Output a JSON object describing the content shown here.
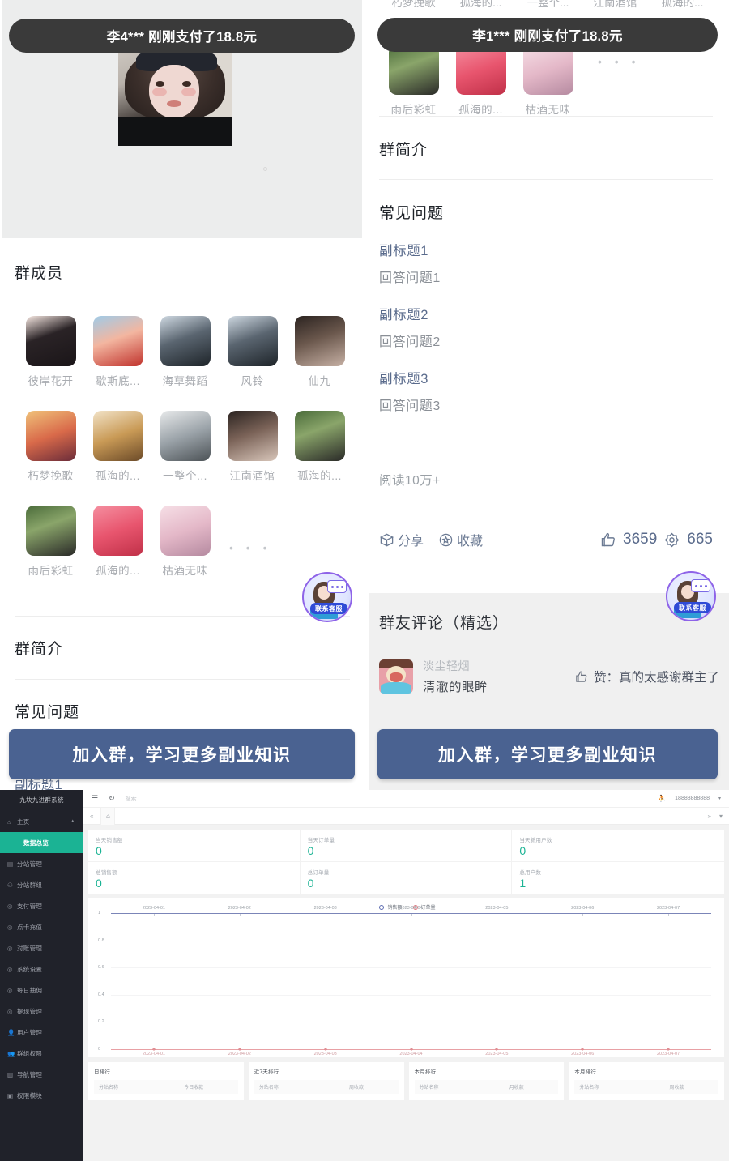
{
  "mobile": {
    "toast_left": "李4*** 刚刚支付了18.8元",
    "toast_right": "李1*** 刚刚支付了18.8元",
    "members_title": "群成员",
    "members": [
      {
        "name": "彼岸花开"
      },
      {
        "name": "歇斯底..."
      },
      {
        "name": "海草舞蹈"
      },
      {
        "name": "风铃"
      },
      {
        "name": "仙九"
      },
      {
        "name": "朽梦挽歌"
      },
      {
        "name": "孤海的..."
      },
      {
        "name": "一整个..."
      },
      {
        "name": "江南酒馆"
      },
      {
        "name": "孤海的..."
      },
      {
        "name": "雨后彩虹"
      },
      {
        "name": "孤海的..."
      },
      {
        "name": "枯酒无味"
      }
    ],
    "more_dots": "• • •",
    "intro_title": "群简介",
    "faq_title": "常见问题",
    "faq": [
      {
        "q": "副标题1",
        "a": "回答问题1"
      },
      {
        "q": "副标题2",
        "a": "回答问题2"
      },
      {
        "q": "副标题3",
        "a": "回答问题3"
      }
    ],
    "read_count": "阅读10万+",
    "share_label": "分享",
    "favorite_label": "收藏",
    "like_count": "3659",
    "star_count": "665",
    "comments_title": "群友评论（精选）",
    "comment": {
      "author": "淡尘轻烟",
      "text": "清澈的眼眸",
      "like_text": "赞：真的太感谢群主了"
    },
    "cta_label": "加入群，学习更多副业知识",
    "cs_badge_label": "联系客服"
  },
  "admin": {
    "logo": "九块九进群系统",
    "topbar": {
      "search_placeholder": "搜索",
      "user": "18888888888",
      "menu_icon": "menu-icon",
      "refresh_icon": "refresh-icon",
      "fullscreen_icon": "fullscreen-icon"
    },
    "menu": [
      {
        "label": "主页",
        "icon": "home-icon",
        "active": false,
        "sub": false,
        "caret": "▲"
      },
      {
        "label": "数据总览",
        "icon": "",
        "active": true,
        "sub": true
      },
      {
        "label": "分站管理",
        "icon": "grid-icon",
        "active": false,
        "sub": false
      },
      {
        "label": "分站群组",
        "icon": "group-icon",
        "active": false,
        "sub": false
      },
      {
        "label": "支付管理",
        "icon": "check-icon",
        "active": false,
        "sub": false
      },
      {
        "label": "点卡充值",
        "icon": "check-icon",
        "active": false,
        "sub": false
      },
      {
        "label": "对账管理",
        "icon": "check-icon",
        "active": false,
        "sub": false
      },
      {
        "label": "系统设置",
        "icon": "check-icon",
        "active": false,
        "sub": false
      },
      {
        "label": "每日抽佣",
        "icon": "check-icon",
        "active": false,
        "sub": false
      },
      {
        "label": "提现管理",
        "icon": "check-icon",
        "active": false,
        "sub": false
      },
      {
        "label": "用户管理",
        "icon": "user-icon",
        "active": false,
        "sub": false
      },
      {
        "label": "群组权限",
        "icon": "users-icon",
        "active": false,
        "sub": false
      },
      {
        "label": "导航管理",
        "icon": "chart-icon",
        "active": false,
        "sub": false
      },
      {
        "label": "权限模块",
        "icon": "module-icon",
        "active": false,
        "sub": false
      }
    ],
    "stats": [
      {
        "label": "当天销售额",
        "value": "0"
      },
      {
        "label": "当天订单量",
        "value": "0"
      },
      {
        "label": "当天新用户数",
        "value": "0"
      },
      {
        "label": "总销售额",
        "value": "0"
      },
      {
        "label": "总订单量",
        "value": "0"
      },
      {
        "label": "总用户数",
        "value": "1"
      }
    ],
    "rankings": [
      {
        "title": "日排行",
        "col1": "分站名称",
        "col2": "今日收款"
      },
      {
        "title": "近7天排行",
        "col1": "分站名称",
        "col2": "周收款"
      },
      {
        "title": "本月排行",
        "col1": "分站名称",
        "col2": "月收款"
      },
      {
        "title": "本月排行",
        "col1": "分站名称",
        "col2": "周收款"
      }
    ],
    "colors": {
      "accent": "#1bb394",
      "sidebar": "#20222a",
      "series_sales": "#5b6ab0",
      "series_orders": "#d9757c"
    }
  },
  "chart_data": {
    "type": "line",
    "title": "",
    "x": [
      "2023-04-01",
      "2023-04-02",
      "2023-04-03",
      "2023-04-04",
      "2023-04-05",
      "2023-04-06",
      "2023-04-07"
    ],
    "series": [
      {
        "name": "销售额",
        "color": "#5b6ab0",
        "values": [
          0,
          0,
          0,
          0,
          0,
          0,
          0
        ]
      },
      {
        "name": "订单量",
        "color": "#d9757c",
        "values": [
          0,
          0,
          0,
          0,
          0,
          0,
          0
        ]
      }
    ],
    "yticks": [
      "1",
      "0.8",
      "0.6",
      "0.4",
      "0.2",
      "0"
    ],
    "ylim": [
      0,
      1
    ],
    "xlabel": "",
    "ylabel": "",
    "grid": true,
    "legend_position": "top-center"
  }
}
